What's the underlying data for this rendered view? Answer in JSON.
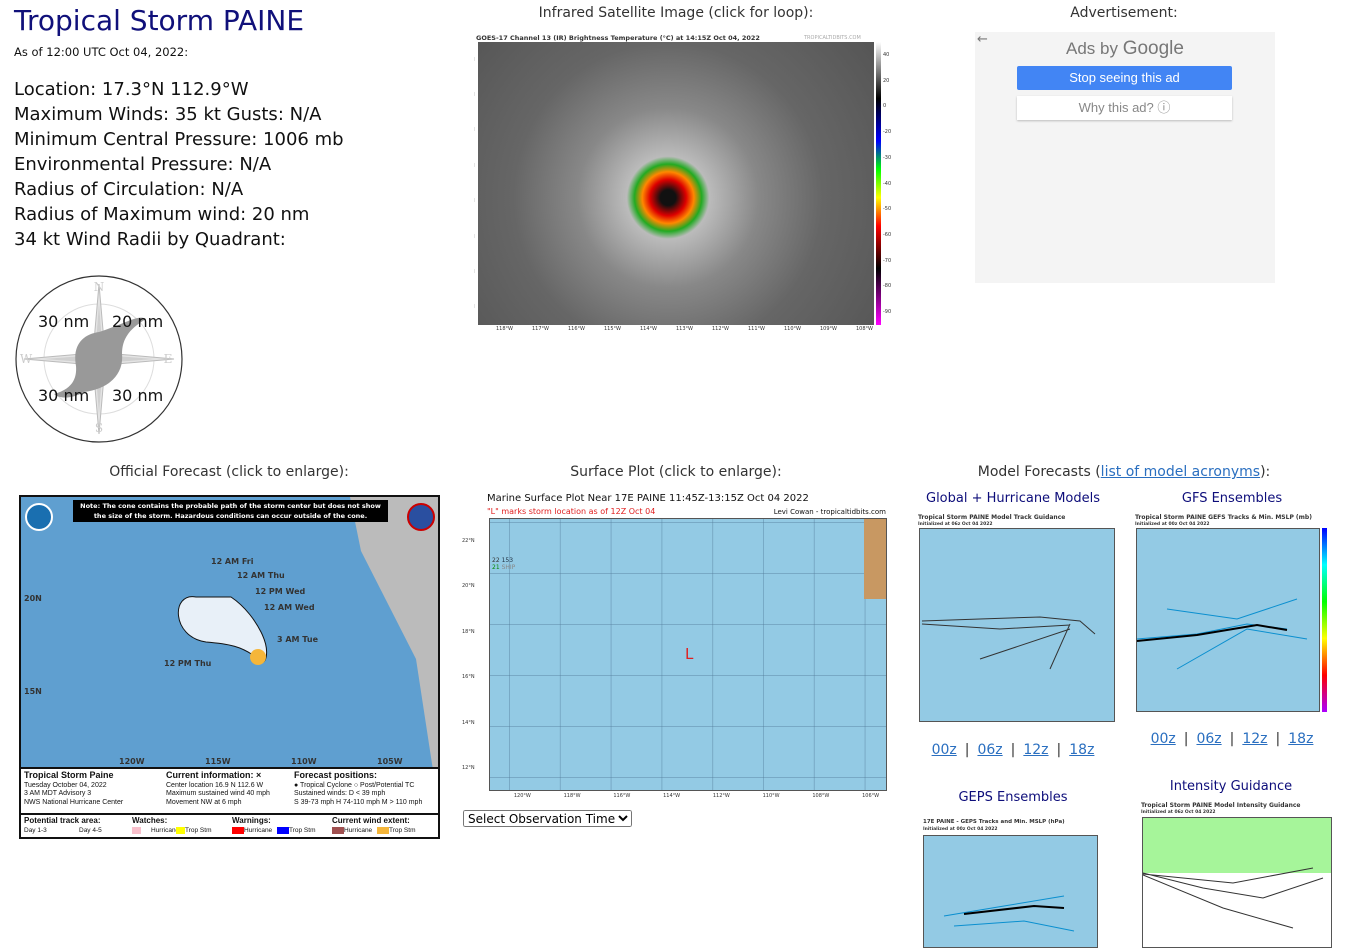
{
  "storm": {
    "title": "Tropical Storm PAINE",
    "as_of": "As of 12:00 UTC Oct 04, 2022:",
    "lines": [
      "Location: 17.3°N 112.9°W",
      "Maximum Winds: 35 kt  Gusts: N/A",
      "Minimum Central Pressure: 1006 mb",
      "Environmental Pressure: N/A",
      "Radius of Circulation: N/A",
      "Radius of Maximum wind: 20 nm",
      "34 kt Wind Radii by Quadrant:"
    ],
    "wind_radii": {
      "nw": "30 nm",
      "ne": "20 nm",
      "sw": "30 nm",
      "se": "30 nm"
    },
    "compass": {
      "n": "N",
      "s": "S",
      "e": "E",
      "w": "W"
    }
  },
  "satellite": {
    "caption": "Infrared Satellite Image (click for loop):",
    "header": "GOES-17 Channel 13 (IR) Brightness Temperature (°C) at 14:15Z Oct 04, 2022",
    "credit": "TROPICALTIDBITS.COM",
    "lat_ticks": [
      "21°N",
      "20°N",
      "19°N",
      "18°N",
      "17°N",
      "16°N",
      "15°N",
      "14°N"
    ],
    "lon_ticks": [
      "118°W",
      "117°W",
      "116°W",
      "115°W",
      "114°W",
      "113°W",
      "112°W",
      "111°W",
      "110°W",
      "109°W",
      "108°W"
    ],
    "scale_ticks": [
      "40",
      "20",
      "0",
      "-20",
      "-30",
      "-40",
      "-50",
      "-60",
      "-70",
      "-80",
      "-90"
    ]
  },
  "ad": {
    "caption": "Advertisement:",
    "ads_by": "Ads by ",
    "google": "Google",
    "stop": "Stop seeing this ad",
    "why": "Why this ad? ⓘ",
    "back_icon": "←",
    "accent": "#4285f4"
  },
  "official": {
    "caption": "Official Forecast (click to enlarge):",
    "note": "Note: The cone contains the probable path of the storm center but does not show the size of the storm. Hazardous conditions can occur outside of the cone.",
    "labels": [
      "12 AM Fri",
      "12 AM Thu",
      "12 PM Wed",
      "12 AM Wed",
      "3 AM Tue",
      "12 PM Thu"
    ],
    "lat": [
      "20N",
      "15N"
    ],
    "lon": [
      "120W",
      "115W",
      "110W",
      "105W"
    ],
    "legend": {
      "name": "Tropical Storm Paine",
      "date": "Tuesday October 04, 2022",
      "adv": "3 AM MDT Advisory 3",
      "center": "NWS National Hurricane Center",
      "cur_title": "Current information: ×",
      "cur": [
        "Center location 16.9 N 112.6 W",
        "Maximum sustained wind 40 mph",
        "Movement NW at 6 mph"
      ],
      "fc_title": "Forecast positions:",
      "fc": [
        "● Tropical Cyclone  ○ Post/Potential TC",
        "Sustained winds:      D < 39 mph",
        "S 39-73 mph  H 74-110 mph  M > 110 mph"
      ],
      "track": "Potential track area:",
      "day13": "Day 1-3",
      "day45": "Day 4-5",
      "watches": "Watches:",
      "warnings": "Warnings:",
      "extent": "Current wind extent:",
      "hurricane": "Hurricane",
      "tropstm": "Trop Stm"
    }
  },
  "surface": {
    "caption": "Surface Plot (click to enlarge):",
    "title": "Marine Surface Plot Near 17E PAINE 11:45Z-13:15Z Oct 04 2022",
    "subtitle": "\"L\" marks storm location as of 12Z Oct 04",
    "credit": "Levi Cowan - tropicaltidbits.com",
    "marker": "L",
    "lat_ticks": [
      "22°N",
      "20°N",
      "18°N",
      "16°N",
      "14°N",
      "12°N"
    ],
    "lon_ticks": [
      "120°W",
      "118°W",
      "116°W",
      "114°W",
      "112°W",
      "110°W",
      "108°W",
      "106°W"
    ],
    "station": {
      "temp": "22",
      "dew": "21",
      "pres": "153",
      "id": "SHIP"
    },
    "select": "Select Observation Time..."
  },
  "models": {
    "caption_pre": "Model Forecasts (",
    "caption_link": "list of model acronyms",
    "caption_post": "):",
    "global": {
      "title": "Global + Hurricane Models",
      "img_title": "Tropical Storm PAINE Model Track Guidance",
      "init": "Initialized at 06z Oct 04 2022"
    },
    "gfs": {
      "title": "GFS Ensembles",
      "img_title": "Tropical Storm PAINE GEFS Tracks & Min. MSLP (mb)",
      "init": "Initialized at 00z Oct 04 2022"
    },
    "geps": {
      "title": "GEPS Ensembles",
      "img_title": "17E PAINE - GEPS Tracks and Min. MSLP (hPa)",
      "init": "Initialized at 00z Oct 04 2022"
    },
    "intensity": {
      "title": "Intensity Guidance",
      "img_title": "Tropical Storm PAINE Model Intensity Guidance",
      "init": "Initialized at 06z Oct 04 2022"
    },
    "runs": [
      "00z",
      "06z",
      "12z",
      "18z"
    ],
    "sep": "|"
  }
}
